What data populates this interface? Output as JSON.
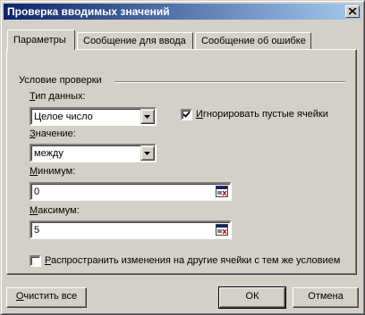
{
  "window": {
    "title": "Проверка вводимых значений"
  },
  "tabs": [
    {
      "label": "Параметры",
      "active": true
    },
    {
      "label": "Сообщение для ввода",
      "active": false
    },
    {
      "label": "Сообщение об ошибке",
      "active": false
    }
  ],
  "validation": {
    "group_title": "Условие проверки",
    "data_type": {
      "label_underlined": "Т",
      "label_rest": "ип данных:",
      "value": "Целое число"
    },
    "data_value": {
      "label_underlined": "З",
      "label_rest": "начение:",
      "value": "между"
    },
    "ignore_blank": {
      "label_underlined": "И",
      "label_rest": "гнорировать пустые ячейки",
      "checked": true
    },
    "minimum": {
      "label_underlined": "М",
      "label_rest": "инимум:",
      "value": "0"
    },
    "maximum": {
      "label_underlined": "М",
      "label_rest": "аксимум:",
      "value": "5"
    },
    "apply_to_all": {
      "label_underlined": "Р",
      "label_rest": "аспространить изменения на другие ячейки с тем же условием",
      "checked": false
    }
  },
  "buttons": {
    "clear_all_underlined": "О",
    "clear_all_rest": "чистить все",
    "ok": "ОК",
    "cancel": "Отмена"
  },
  "colors": {
    "title_start": "#0a246a",
    "title_end": "#a6caf0",
    "face": "#d4d0c8"
  },
  "icons": {
    "close": "close-icon",
    "dropdown": "chevron-down-icon",
    "range_picker": "collapse-dialog-icon",
    "check": "check-icon"
  }
}
